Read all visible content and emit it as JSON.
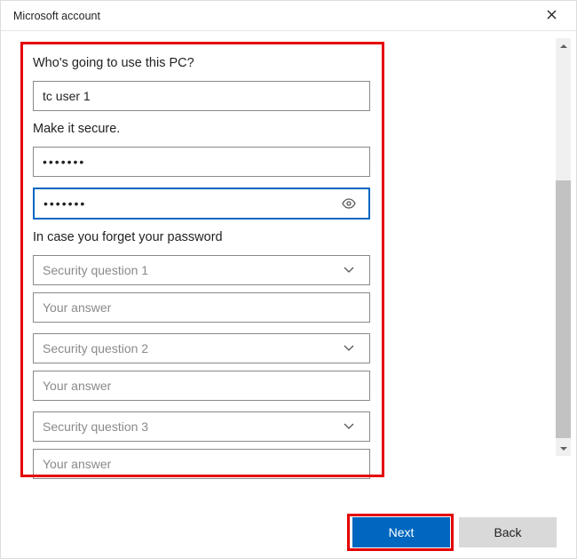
{
  "window": {
    "title": "Microsoft account"
  },
  "form": {
    "username_label": "Who's going to use this PC?",
    "username_value": "tc user 1",
    "password_label": "Make it secure.",
    "password_value": "•••••••",
    "confirm_value": "•••••••",
    "security_label": "In case you forget your password",
    "questions": [
      {
        "placeholder": "Security question 1",
        "answer_placeholder": "Your answer"
      },
      {
        "placeholder": "Security question 2",
        "answer_placeholder": "Your answer"
      },
      {
        "placeholder": "Security question 3",
        "answer_placeholder": "Your answer"
      }
    ]
  },
  "footer": {
    "next": "Next",
    "back": "Back"
  }
}
